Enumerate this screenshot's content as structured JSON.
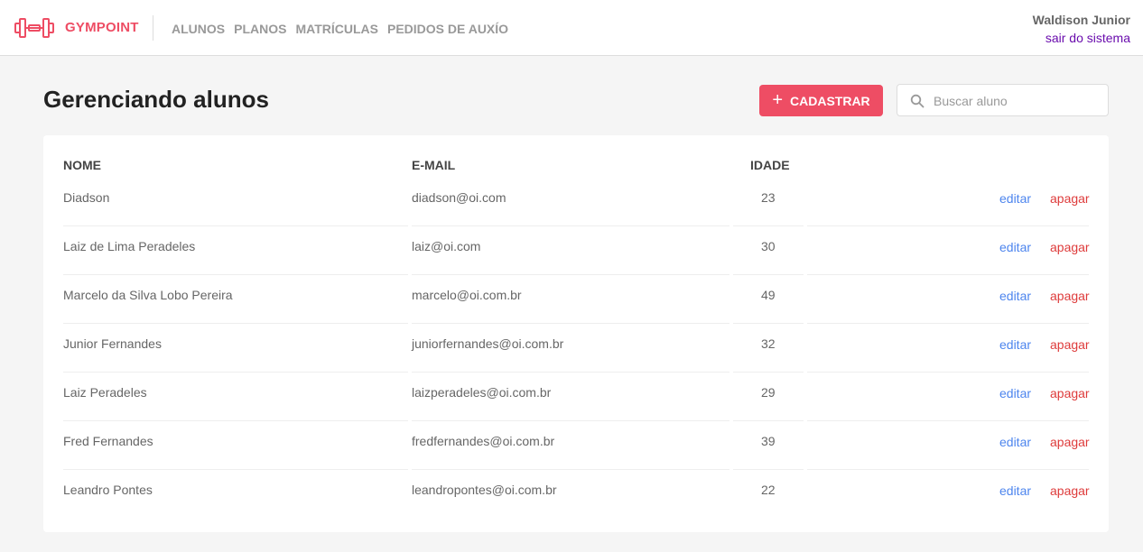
{
  "header": {
    "brand": "GYMPOINT",
    "nav": [
      "ALUNOS",
      "PLANOS",
      "MATRÍCULAS",
      "PEDIDOS DE AUXÍO"
    ],
    "user_name": "Waldison Junior",
    "logout": "sair do sistema"
  },
  "page": {
    "title": "Gerenciando alunos",
    "add_button": "CADASTRAR",
    "search_placeholder": "Buscar aluno"
  },
  "table": {
    "headers": {
      "name": "NOME",
      "email": "E-MAIL",
      "age": "IDADE"
    },
    "edit_label": "editar",
    "delete_label": "apagar",
    "rows": [
      {
        "name": "Diadson",
        "email": "diadson@oi.com",
        "age": "23"
      },
      {
        "name": "Laiz de Lima Peradeles",
        "email": "laiz@oi.com",
        "age": "30"
      },
      {
        "name": "Marcelo da Silva Lobo Pereira",
        "email": "marcelo@oi.com.br",
        "age": "49"
      },
      {
        "name": "Junior Fernandes",
        "email": "juniorfernandes@oi.com.br",
        "age": "32"
      },
      {
        "name": "Laiz Peradeles",
        "email": "laizperadeles@oi.com.br",
        "age": "29"
      },
      {
        "name": "Fred Fernandes",
        "email": "fredfernandes@oi.com.br",
        "age": "39"
      },
      {
        "name": "Leandro Pontes",
        "email": "leandropontes@oi.com.br",
        "age": "22"
      }
    ]
  },
  "colors": {
    "brand": "#ee4d64",
    "edit": "#4d85ee",
    "delete": "#de3b3b",
    "logout": "#6a0dad"
  },
  "icons": {
    "logo": "dumbbell-icon",
    "search": "search-icon",
    "add": "plus-icon"
  }
}
